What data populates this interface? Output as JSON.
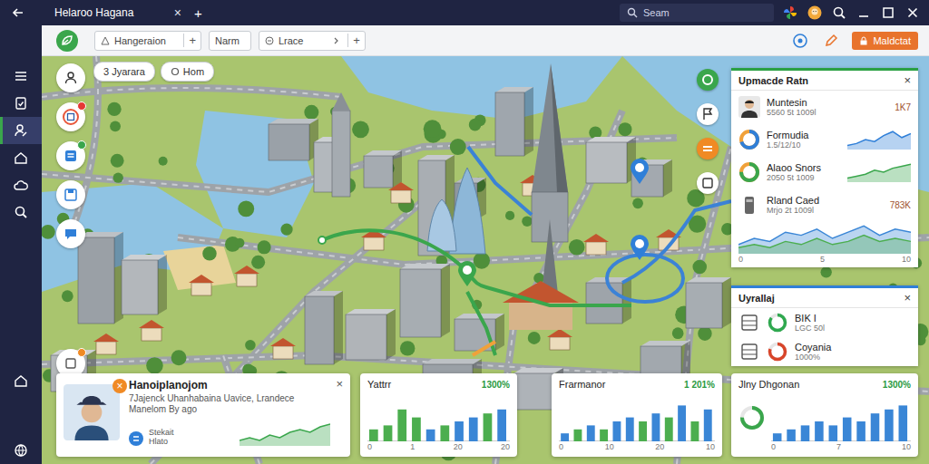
{
  "window": {
    "title": "Helaroo Hagana",
    "tab_close": "×",
    "new_tab": "+"
  },
  "search": {
    "placeholder": "Seam"
  },
  "sidebar": {
    "items": [
      {
        "selected": false
      },
      {
        "selected": false
      },
      {
        "selected": true
      },
      {
        "selected": false
      },
      {
        "selected": false
      },
      {
        "selected": false
      },
      {
        "selected": false
      },
      {
        "selected": false
      }
    ]
  },
  "toolbar": {
    "fields": [
      {
        "value": "Hangeraion",
        "action": "+"
      },
      {
        "value": "Narm"
      },
      {
        "value": "Lrace",
        "action": "+"
      }
    ],
    "button": "Maldctat"
  },
  "map": {
    "chips": [
      "3 Jyarara",
      "Hom"
    ],
    "tools": [
      {
        "badge": false
      },
      {
        "badge": true,
        "color": "#e53935"
      },
      {
        "badge": true,
        "color": "#3aa64c"
      },
      {
        "badge": false
      },
      {
        "badge": false
      },
      {
        "badge": true,
        "color": "#f08a24"
      }
    ]
  },
  "panels": [
    {
      "title": "Upmacde Ratn",
      "close": "×",
      "items": [
        {
          "kind": "avatar",
          "name": "Muntesin",
          "detail": "5560 5t 1009l",
          "value": "1K7"
        },
        {
          "kind": "donut",
          "name": "Formudia",
          "detail": "1.5/12/10",
          "level": 0.7,
          "color": "#2f7fd8",
          "chart": [
            2,
            3,
            5,
            4,
            7,
            9,
            6,
            8
          ]
        },
        {
          "kind": "donut",
          "name": "Alaoo Snors",
          "detail": "2050 5t 1009",
          "level": 0.75,
          "color": "#3aa64c",
          "chart": [
            2,
            3,
            4,
            6,
            5,
            7,
            8,
            9
          ]
        },
        {
          "kind": "device",
          "name": "Rland Caed",
          "detail": "Mrjo 2t 1009l",
          "value": "783K"
        }
      ],
      "chart": {
        "series": [
          {
            "color": "#3a86d6",
            "values": [
              3,
              5,
              4,
              7,
              6,
              8,
              5,
              7,
              9,
              6,
              8,
              7
            ]
          },
          {
            "color": "#4cae4f",
            "values": [
              2,
              3,
              2,
              4,
              3,
              5,
              3,
              4,
              6,
              4,
              5,
              4
            ]
          }
        ],
        "ticks": [
          "0",
          "5",
          "10"
        ]
      }
    },
    {
      "title": "Uyrallaj",
      "close": "×",
      "items": [
        {
          "name": "BIK I",
          "detail": "LGC 50l",
          "level": 0.85,
          "color": "#2fa84f"
        },
        {
          "name": "Coyania",
          "detail": "1000%",
          "level": 0.8,
          "color": "#d8452a"
        }
      ]
    }
  ],
  "profile": {
    "name": "Hanoiplanojom",
    "description": "7Jajenck Uhanhabaina Uavice, Lrandece Manelom By ago",
    "footer": [
      "Stekait",
      "Hlato"
    ],
    "badge": "×",
    "close": "×",
    "chart": [
      2,
      3,
      2,
      4,
      3,
      5,
      6,
      5,
      7,
      8
    ]
  },
  "charts": [
    {
      "title": "Yattrr",
      "value": "1300%",
      "donut": false,
      "ticks": [
        "0",
        "1",
        "20",
        "20"
      ],
      "bars": [
        {
          "value": 3,
          "color": "#4cae4f"
        },
        {
          "value": 4,
          "color": "#4cae4f"
        },
        {
          "value": 8,
          "color": "#4cae4f"
        },
        {
          "value": 6,
          "color": "#4cae4f"
        },
        {
          "value": 3,
          "color": "#3a86d6"
        },
        {
          "value": 4,
          "color": "#4cae4f"
        },
        {
          "value": 5,
          "color": "#3a86d6"
        },
        {
          "value": 6,
          "color": "#3a86d6"
        },
        {
          "value": 7,
          "color": "#4cae4f"
        },
        {
          "value": 8,
          "color": "#3a86d6"
        }
      ]
    },
    {
      "title": "Frarmanor",
      "value": "1 201%",
      "donut": false,
      "ticks": [
        "0",
        "10",
        "20",
        "10"
      ],
      "bars": [
        {
          "value": 2,
          "color": "#3a86d6"
        },
        {
          "value": 3,
          "color": "#4cae4f"
        },
        {
          "value": 4,
          "color": "#3a86d6"
        },
        {
          "value": 3,
          "color": "#4cae4f"
        },
        {
          "value": 5,
          "color": "#3a86d6"
        },
        {
          "value": 6,
          "color": "#3a86d6"
        },
        {
          "value": 5,
          "color": "#4cae4f"
        },
        {
          "value": 7,
          "color": "#3a86d6"
        },
        {
          "value": 6,
          "color": "#4cae4f"
        },
        {
          "value": 9,
          "color": "#3a86d6"
        },
        {
          "value": 5,
          "color": "#4cae4f"
        },
        {
          "value": 8,
          "color": "#3a86d6"
        }
      ]
    },
    {
      "title": "Jlny Dhgonan",
      "value": "1300%",
      "donut": true,
      "level": 0.75,
      "ticks": [
        "0",
        "7",
        "10"
      ],
      "bars": [
        {
          "value": 2,
          "color": "#3a86d6"
        },
        {
          "value": 3,
          "color": "#3a86d6"
        },
        {
          "value": 4,
          "color": "#3a86d6"
        },
        {
          "value": 5,
          "color": "#3a86d6"
        },
        {
          "value": 4,
          "color": "#3a86d6"
        },
        {
          "value": 6,
          "color": "#3a86d6"
        },
        {
          "value": 5,
          "color": "#3a86d6"
        },
        {
          "value": 7,
          "color": "#3a86d6"
        },
        {
          "value": 8,
          "color": "#3a86d6"
        },
        {
          "value": 9,
          "color": "#3a86d6"
        }
      ]
    }
  ]
}
